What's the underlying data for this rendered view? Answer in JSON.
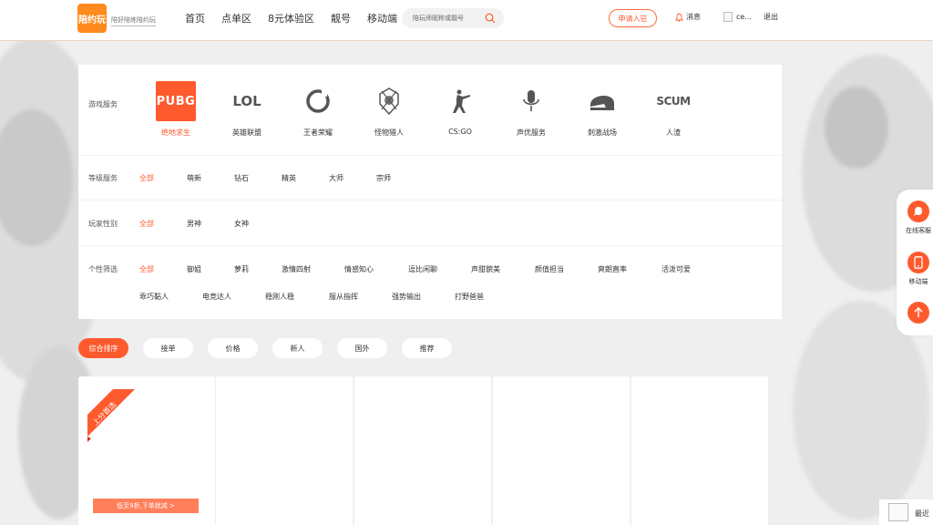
{
  "header": {
    "logo_text": "陪约玩",
    "slogan": "陪好陪练陪约玩",
    "nav": [
      "首页",
      "点单区",
      "8元体验区",
      "靓号",
      "移动端"
    ],
    "search_placeholder": "陪玩师昵称或靓号",
    "apply_label": "申请入驻",
    "message_label": "消息",
    "user_name": "ce...",
    "logout_label": "退出"
  },
  "filters": {
    "game_label": "游戏服务",
    "games": [
      {
        "name": "绝地求生",
        "logo": "PUBG",
        "icon": "pubg-logo",
        "active": true
      },
      {
        "name": "英雄联盟",
        "logo": "LOL",
        "icon": "lol-logo",
        "active": false
      },
      {
        "name": "王者荣耀",
        "logo": "",
        "icon": "honor-of-kings-logo",
        "active": false
      },
      {
        "name": "怪物猎人",
        "logo": "",
        "icon": "monster-hunter-logo",
        "active": false
      },
      {
        "name": "CS:GO",
        "logo": "",
        "icon": "csgo-logo",
        "active": false
      },
      {
        "name": "声优服务",
        "logo": "",
        "icon": "microphone-icon",
        "active": false
      },
      {
        "name": "刺激战场",
        "logo": "",
        "icon": "helmet-icon",
        "active": false
      },
      {
        "name": "人渣",
        "logo": "SCUM",
        "icon": "scum-logo",
        "active": false
      }
    ],
    "level_label": "等级服务",
    "levels": [
      "全部",
      "萌新",
      "钻石",
      "精英",
      "大师",
      "宗师"
    ],
    "gender_label": "玩家性别",
    "genders": [
      "全部",
      "男神",
      "女神"
    ],
    "personality_label": "个性筛选",
    "personality_row1": [
      "全部",
      "御姐",
      "萝莉",
      "激情四射",
      "情感知心",
      "逗比闲聊",
      "声甜貌美",
      "颜值担当",
      "爽朗直率",
      "活泼可爱"
    ],
    "personality_row2": [
      "乖巧黏人",
      "电竞达人",
      "稳刚人稳",
      "服从指挥",
      "强势输出",
      "打野爸爸"
    ]
  },
  "sort_tabs": [
    "综合排序",
    "接单",
    "价格",
    "新人",
    "国外",
    "推荐"
  ],
  "cards": {
    "ribbon_text": "上分首选",
    "promo_text": "低至9折,下单就减 >"
  },
  "sidebar": {
    "service_label": "在线客服",
    "mobile_label": "移动端"
  },
  "recent_label": "最近",
  "colors": {
    "accent": "#ff5a2e",
    "logo": "#ff8a1e"
  }
}
